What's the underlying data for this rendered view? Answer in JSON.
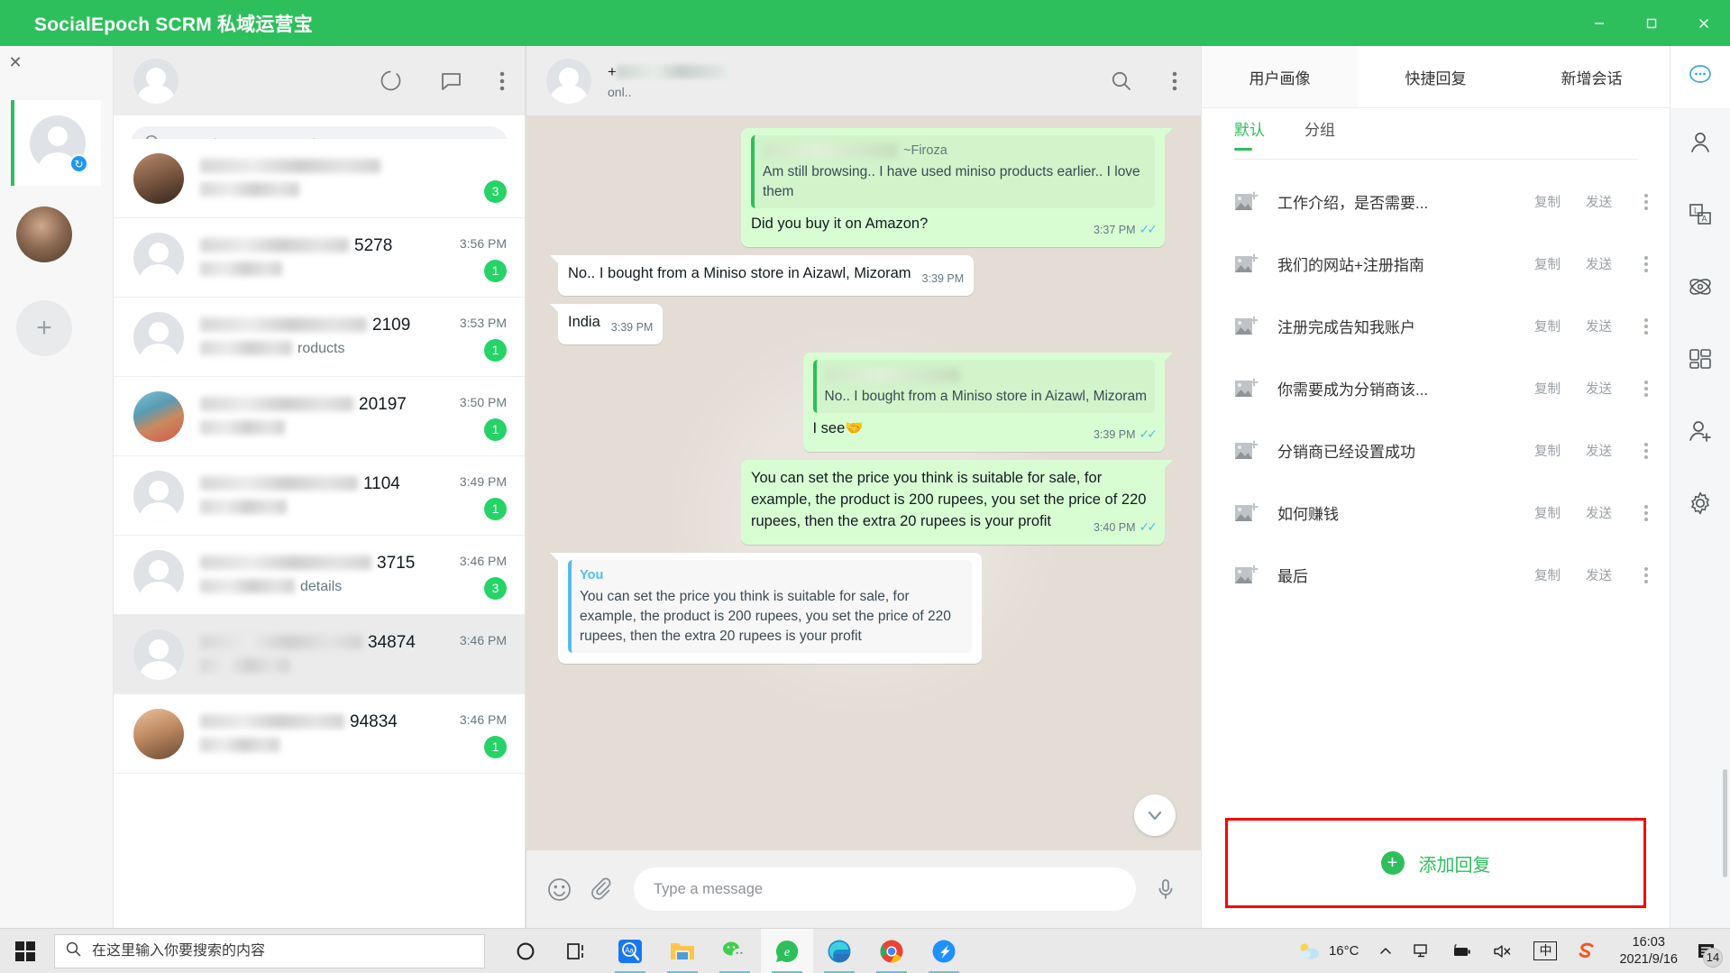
{
  "window": {
    "title": "SocialEpoch SCRM 私域运营宝",
    "minimize_label": "—",
    "maximize_label": "▢",
    "close_label": "✕",
    "accent_color": "#2dbf5c"
  },
  "rail": {
    "close_label": "✕",
    "account_badge": "↻",
    "add_label": "+"
  },
  "chat_list": {
    "search_placeholder": "Search or start new chat",
    "items": [
      {
        "name_suffix": "",
        "preview": "",
        "time": "",
        "badge": "3",
        "avatar": "pic-person",
        "selected": false,
        "partial": true
      },
      {
        "name_suffix": "5278",
        "preview": "",
        "time": "3:56 PM",
        "badge": "1",
        "avatar": "gray",
        "selected": false
      },
      {
        "name_suffix": "2109",
        "preview": "roducts",
        "time": "3:53 PM",
        "badge": "1",
        "avatar": "gray",
        "selected": false
      },
      {
        "name_suffix": "20197",
        "preview": "",
        "time": "3:50 PM",
        "badge": "1",
        "avatar": "pic-hindu",
        "selected": false
      },
      {
        "name_suffix": "1104",
        "preview": "",
        "time": "3:49 PM",
        "badge": "1",
        "avatar": "gray",
        "selected": false
      },
      {
        "name_suffix": "3715",
        "preview": "details",
        "time": "3:46 PM",
        "badge": "3",
        "avatar": "gray",
        "selected": false
      },
      {
        "name_suffix": "34874",
        "preview": "",
        "time": "3:46 PM",
        "badge": "",
        "avatar": "gray",
        "selected": true
      },
      {
        "name_suffix": "94834",
        "preview": "",
        "time": "3:46 PM",
        "badge": "1",
        "avatar": "pic-girl",
        "selected": false
      }
    ]
  },
  "conversation": {
    "contact_prefix": "+",
    "contact_status": "onl..",
    "messages": [
      {
        "direction": "out",
        "quote_author": "~Firoza",
        "quote_author_blurred": true,
        "quote_text": "Am still browsing.. I have used miniso products earlier.. I love them",
        "text": "Did you buy it on Amazon?",
        "time": "3:37 PM",
        "ticks": true
      },
      {
        "direction": "in",
        "text": "No.. I bought from a Miniso store in Aizawl, Mizoram",
        "time": "3:39 PM",
        "ticks": false
      },
      {
        "direction": "in",
        "text": "India",
        "time": "3:39 PM",
        "ticks": false
      },
      {
        "direction": "out",
        "quote_author": "",
        "quote_author_blurred": true,
        "quote_text": "No.. I bought from a Miniso store in Aizawl, Mizoram",
        "text": "I see🤝",
        "time": "3:39 PM",
        "ticks": true
      },
      {
        "direction": "out",
        "text": "You can set the price you think is suitable for sale, for example, the product is 200 rupees, you set the price of 220 rupees, then the extra 20 rupees is your profit",
        "time": "3:40 PM",
        "ticks": true
      },
      {
        "direction": "in",
        "quote_author": "You",
        "quote_style": "blue",
        "quote_text": "You can set the price you think is suitable for sale, for example, the product is 200 rupees, you set the price of 220 rupees, then the extra 20 rupees is your profit",
        "text": "",
        "time": "",
        "ticks": false
      }
    ],
    "input_placeholder": "Type a message"
  },
  "right_panel": {
    "tabs": [
      {
        "label": "用户画像",
        "active": true
      },
      {
        "label": "快捷回复",
        "active": false
      },
      {
        "label": "新增会话",
        "active": false
      }
    ],
    "subtabs": [
      {
        "label": "默认",
        "active": true
      },
      {
        "label": "分组",
        "active": false
      }
    ],
    "copy_label": "复制",
    "send_label": "发送",
    "replies": [
      {
        "text": "工作介绍，是否需要..."
      },
      {
        "text": "我们的网站+注册指南"
      },
      {
        "text": "注册完成告知我账户"
      },
      {
        "text": "你需要成为分销商该..."
      },
      {
        "text": "分销商已经设置成功"
      },
      {
        "text": "如何赚钱"
      },
      {
        "text": "最后"
      }
    ],
    "add_reply_label": "添加回复",
    "add_reply_plus": "+",
    "highlight_color": "#fa0000"
  },
  "icon_rail": {
    "items": [
      {
        "name": "chat-bubble",
        "active": true
      },
      {
        "name": "contact",
        "active": false
      },
      {
        "name": "translate",
        "active": false
      },
      {
        "name": "ai-assistant",
        "active": false
      },
      {
        "name": "apps-grid",
        "active": false
      },
      {
        "name": "add-friend",
        "active": false
      },
      {
        "name": "settings",
        "active": false
      }
    ]
  },
  "taskbar": {
    "search_placeholder": "在这里输入你要搜索的内容",
    "weather_temp": "16°C",
    "clock_time": "16:03",
    "clock_date": "2021/9/16",
    "notification_count": "14",
    "ime_label": "中",
    "apps": [
      {
        "name": "cortana"
      },
      {
        "name": "task-view"
      },
      {
        "name": "translator-app"
      },
      {
        "name": "file-explorer"
      },
      {
        "name": "wechat"
      },
      {
        "name": "whatsapp-scrm"
      },
      {
        "name": "microsoft-edge"
      },
      {
        "name": "google-chrome"
      },
      {
        "name": "dingtalk"
      }
    ]
  }
}
